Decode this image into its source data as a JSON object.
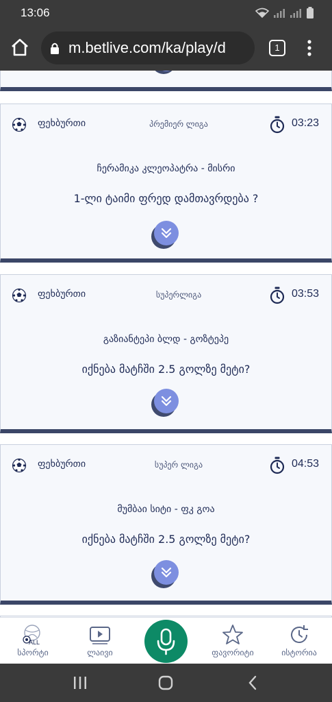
{
  "status": {
    "time": "13:06"
  },
  "browser": {
    "url": "m.betlive.com/ka/play/d",
    "tab_count": "1"
  },
  "cards": [
    {
      "sport": "ფეხბურთი",
      "league": "პრემიერ ლიგა",
      "time": "03:23",
      "match": "ჩერამიკა კლეოპატრა - მისრი",
      "question": "1-ლი ტაიმი ფრედ დამთავრდება ?"
    },
    {
      "sport": "ფეხბურთი",
      "league": "სუპერლიგა",
      "time": "03:53",
      "match": "გაზიანტეპი ბლდ - გოზტეპე",
      "question": "იქნება მატჩში 2.5 გოლზე მეტი?"
    },
    {
      "sport": "ფეხბურთი",
      "league": "სუპერ ლიგა",
      "time": "04:53",
      "match": "მუმბაი სიტი - ფკ გოა",
      "question": "იქნება მატჩში 2.5 გოლზე მეტი?"
    }
  ],
  "bottom_nav": {
    "sports": "სპორტი",
    "sports_badge": "ALL",
    "live": "ლაივი",
    "favorites": "ფავორიტი",
    "history": "ისტორია"
  },
  "colors": {
    "card_bg": "#f6f8fc",
    "card_border_bottom": "#3b4667",
    "expand_button": "#7d8fe0",
    "mic_button": "#0d8a66",
    "text_primary": "#1e2a55"
  }
}
